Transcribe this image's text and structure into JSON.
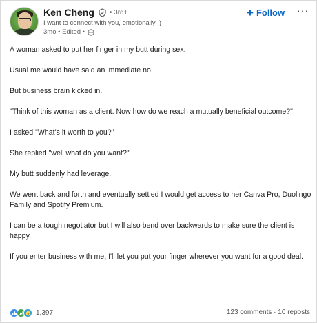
{
  "author": {
    "name": "Ken Cheng",
    "degree": "• 3rd+",
    "headline": "I want to connect with you, emotionally :)",
    "time": "3mo • Edited •"
  },
  "actions": {
    "follow_label": "Follow",
    "more_label": "···"
  },
  "post": {
    "paragraphs": [
      "A woman asked to put her finger in my butt during sex.",
      "Usual me would have said an immediate no.",
      "But business brain kicked in.",
      "\"Think of this woman as a client. Now how do we reach a mutually beneficial outcome?\"",
      "I asked \"What's it worth to you?\"",
      "She replied \"well what do you want?\"",
      "My butt suddenly had leverage.",
      "We went back and forth and eventually settled I would get access to her Canva Pro, Duolingo Family and Spotify Premium.",
      "I can be a tough negotiator but I will also bend over backwards to make sure the client is happy.",
      "If you enter business with me, I'll let you put your finger wherever you want for a good deal."
    ]
  },
  "social": {
    "reaction_count": "1,397",
    "comments_reposts": "123 comments · 10 reposts",
    "reaction_icons": [
      "like-icon",
      "celebrate-icon",
      "funny-icon"
    ]
  },
  "colors": {
    "accent": "#0a66c2",
    "like": "#378fe9",
    "celebrate": "#44a34a"
  }
}
